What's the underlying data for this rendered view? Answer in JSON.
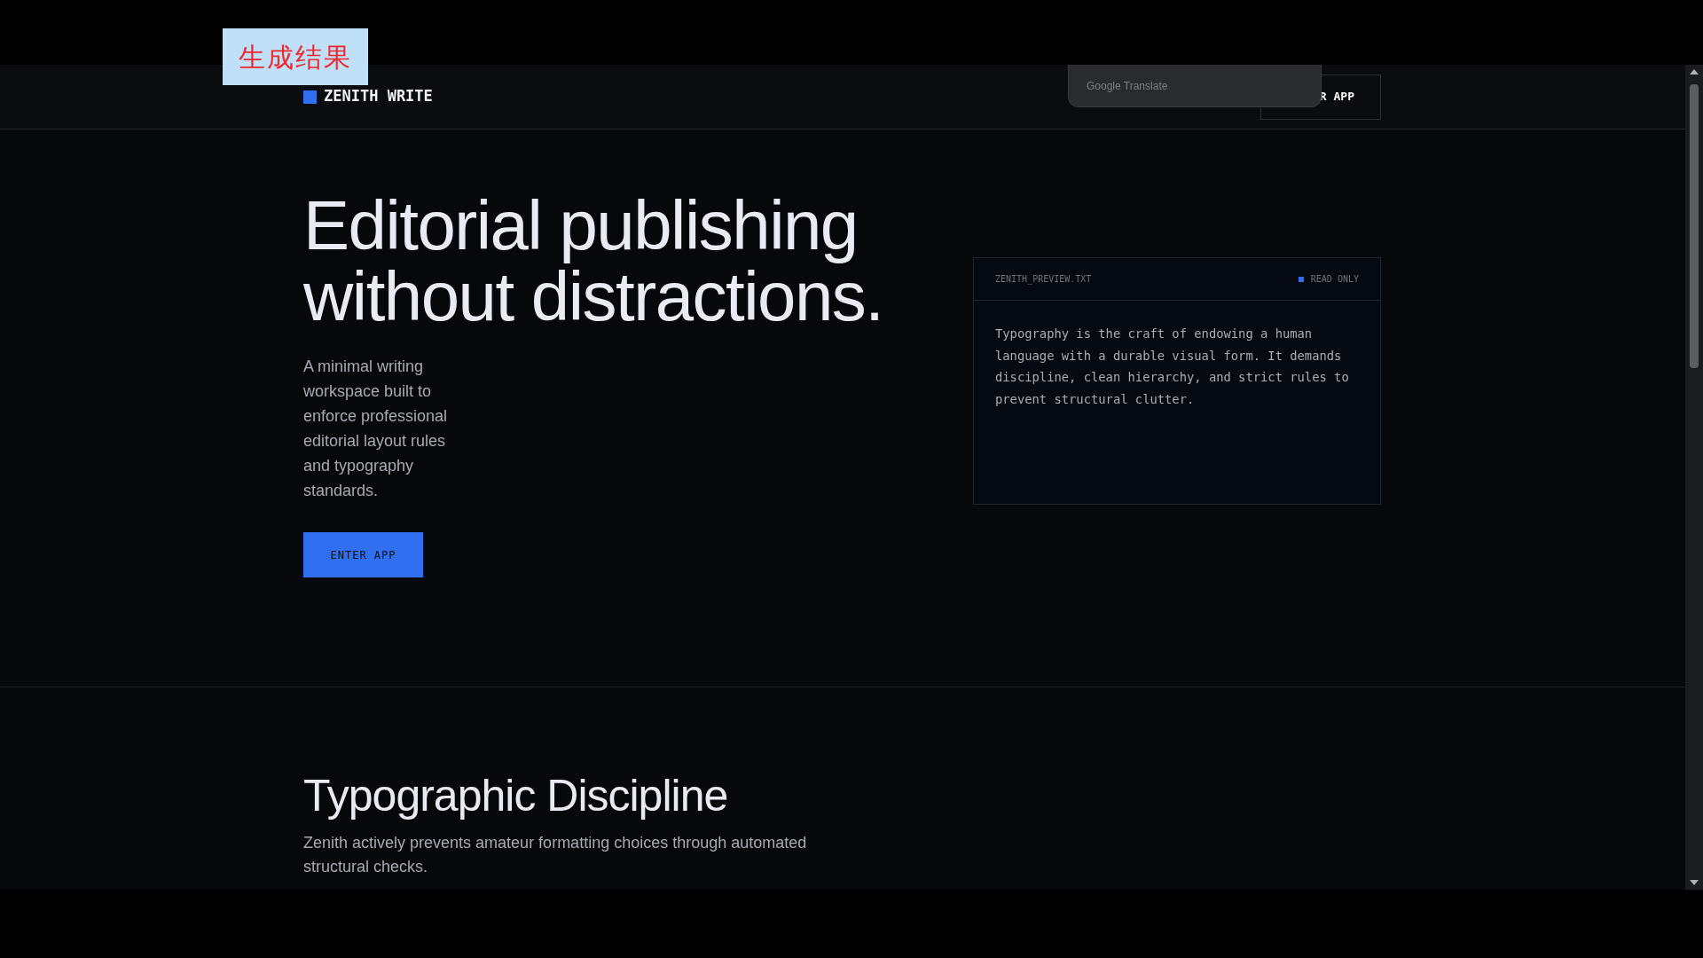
{
  "overlay_label": "生成结果",
  "header": {
    "logo": "ZENITH WRITE",
    "button": "R APP"
  },
  "translate_popup": {
    "text": "Google Translate"
  },
  "hero": {
    "title_lines": [
      "Editorial publishing",
      "without distractions."
    ],
    "description": "A minimal writing workspace built to enforce professional editorial layout rules and typography standards.",
    "button": "ENTER APP"
  },
  "preview": {
    "filename": "ZENITH_PREVIEW.TXT",
    "status": {
      "label": "READ ONLY",
      "color": "#2f6ff0"
    },
    "body": "Typography is the craft of endowing a human language with a durable visual form. It demands discipline, clean hierarchy, and strict rules to prevent structural clutter."
  },
  "section": {
    "title": "Typographic Discipline",
    "description": "Zenith actively prevents amateur formatting choices through automated structural checks."
  }
}
